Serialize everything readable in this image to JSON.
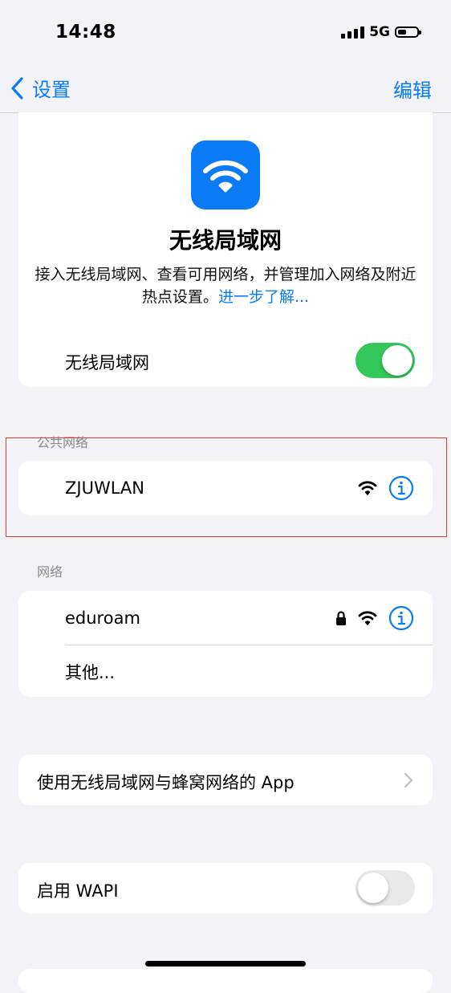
{
  "status_bar": {
    "time": "14:48",
    "network": "5G",
    "battery_level": 0.45
  },
  "nav": {
    "back_label": "设置",
    "edit_label": "编辑"
  },
  "hero": {
    "icon": "wifi-icon",
    "title": "无线局域网",
    "description": "接入无线局域网、查看可用网络，并管理加入网络及附近热点设置。",
    "learn_more": "进一步了解..."
  },
  "wifi_toggle": {
    "label": "无线局域网",
    "on": true
  },
  "public_networks": {
    "header": "公共网络",
    "items": [
      {
        "name": "ZJUWLAN",
        "secured": false
      }
    ]
  },
  "networks": {
    "header": "网络",
    "items": [
      {
        "name": "eduroam",
        "secured": true
      }
    ],
    "other_label": "其他..."
  },
  "apps_row": {
    "label": "使用无线局域网与蜂窝网络的 App"
  },
  "wapi": {
    "label": "启用 WAPI",
    "on": false
  },
  "colors": {
    "accent": "#0a7bf5",
    "toggle_on": "#34c759",
    "highlight": "#e53935"
  }
}
